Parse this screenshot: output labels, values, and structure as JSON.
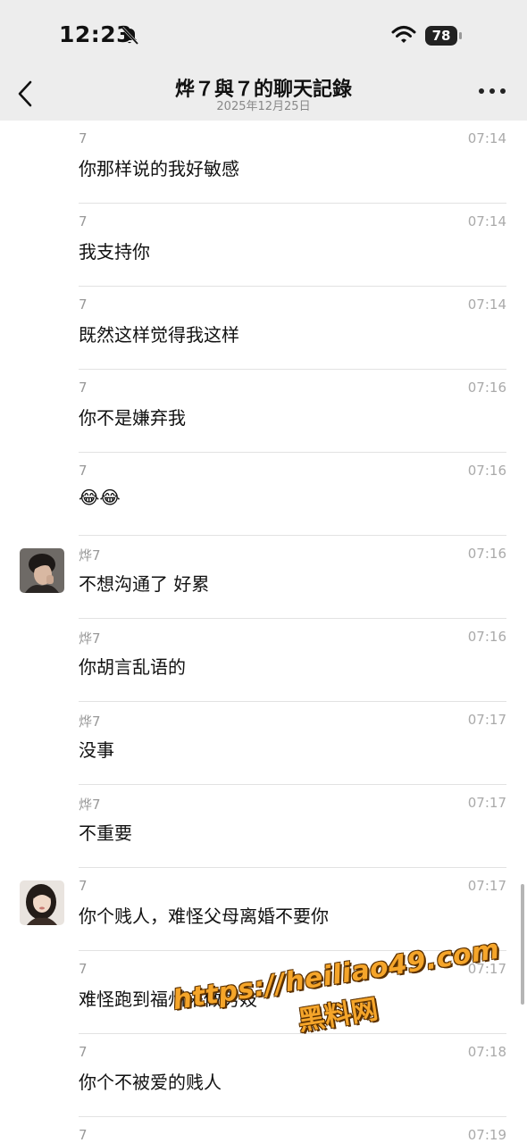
{
  "status_bar": {
    "time": "12:23",
    "battery": "78"
  },
  "header": {
    "title": "烨７與７的聊天記錄",
    "subtitle": "2025年12月25日"
  },
  "messages": [
    {
      "sender": "7",
      "time": "07:14",
      "text": "你那样说的我好敏感",
      "avatar": ""
    },
    {
      "sender": "7",
      "time": "07:14",
      "text": "我支持你",
      "avatar": ""
    },
    {
      "sender": "7",
      "time": "07:14",
      "text": "既然这样觉得我这样",
      "avatar": ""
    },
    {
      "sender": "7",
      "time": "07:16",
      "text": "你不是嫌弃我",
      "avatar": ""
    },
    {
      "sender": "7",
      "time": "07:16",
      "text": "😂😂",
      "avatar": ""
    },
    {
      "sender": "烨7",
      "time": "07:16",
      "text": "不想沟通了 好累",
      "avatar": "male"
    },
    {
      "sender": "烨7",
      "time": "07:16",
      "text": "你胡言乱语的",
      "avatar": ""
    },
    {
      "sender": "烨7",
      "time": "07:17",
      "text": "没事",
      "avatar": ""
    },
    {
      "sender": "烨7",
      "time": "07:17",
      "text": "不重要",
      "avatar": ""
    },
    {
      "sender": "7",
      "time": "07:17",
      "text": "你个贱人，难怪父母离婚不要你",
      "avatar": "female"
    },
    {
      "sender": "7",
      "time": "07:17",
      "text": "难怪跑到福州来做男妓",
      "avatar": ""
    },
    {
      "sender": "7",
      "time": "07:18",
      "text": "你个不被爱的贱人",
      "avatar": ""
    },
    {
      "sender": "7",
      "time": "07:19",
      "text": "",
      "avatar": ""
    }
  ],
  "watermark": {
    "line1": "https://heiliao49.com",
    "line2": "黑料网"
  }
}
